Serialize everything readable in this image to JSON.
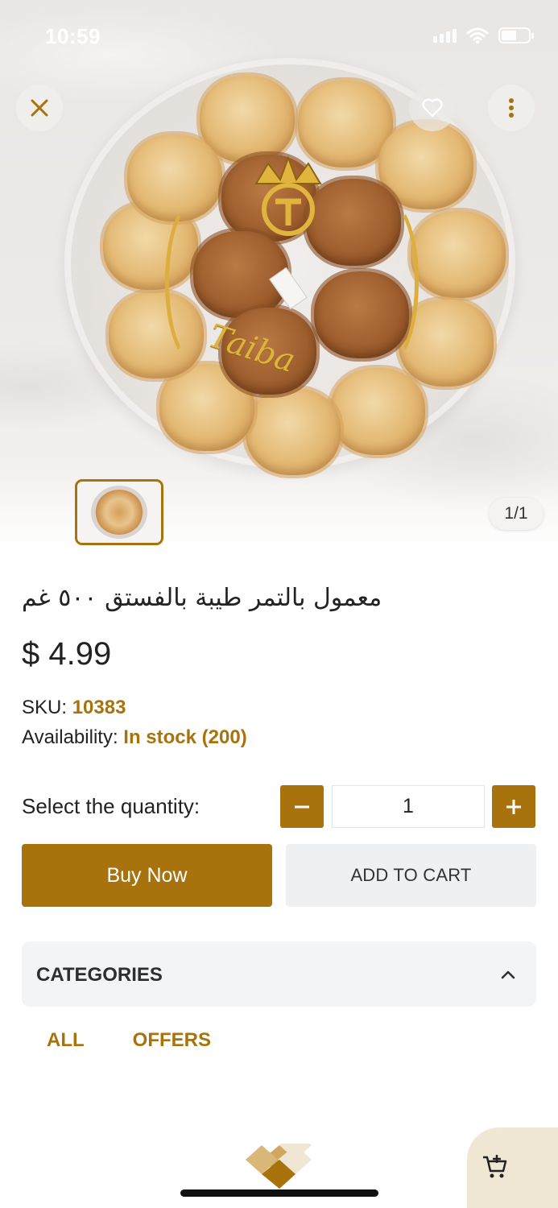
{
  "status_bar": {
    "time": "10:59"
  },
  "gallery": {
    "page_indicator": "1/1",
    "product_mark_text": "Taiba"
  },
  "product": {
    "title": "معمول بالتمر طيبة بالفستق ٥٠٠ غم",
    "price": "$ 4.99",
    "sku_label": "SKU:",
    "sku_value": "10383",
    "availability_label": "Availability:",
    "availability_value": "In stock",
    "availability_count": "(200)"
  },
  "quantity": {
    "label": "Select the quantity:",
    "value": "1",
    "minus_label": "−",
    "plus_label": "+"
  },
  "actions": {
    "buy_now": "Buy Now",
    "add_to_cart": "ADD TO CART"
  },
  "categories": {
    "title": "CATEGORIES",
    "expanded": true,
    "items": [
      "ALL",
      "OFFERS"
    ]
  },
  "colors": {
    "accent": "#a8720d",
    "secondary_button": "#eef0f2",
    "panel": "#f3f4f6",
    "cart_fab": "#efe6d3"
  },
  "icons": {
    "close": "close-icon",
    "favorite": "heart-icon",
    "more": "more-vertical-icon",
    "chevron": "chevron-up-icon",
    "cart": "cart-add-icon"
  }
}
